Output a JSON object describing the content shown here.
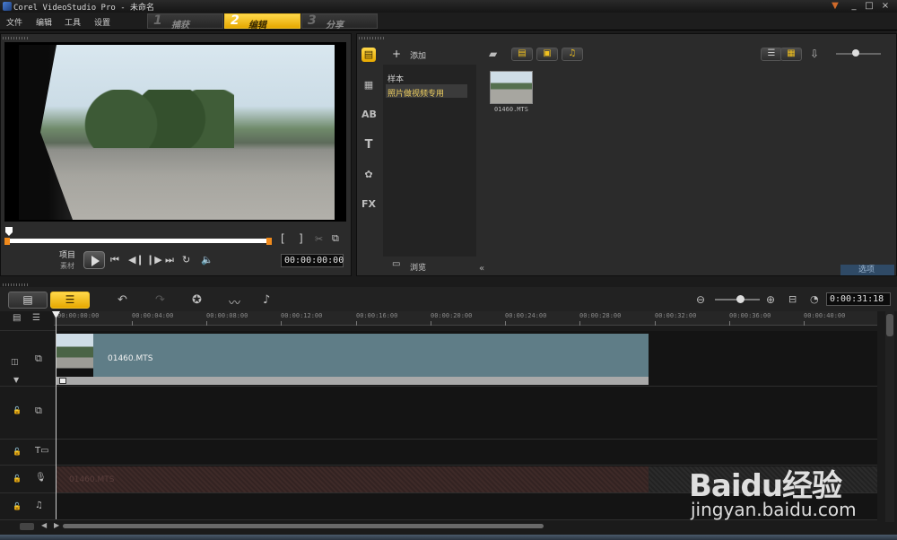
{
  "window": {
    "title": "Corel VideoStudio Pro - 未命名",
    "controls": [
      "▼",
      "_",
      "□",
      "×"
    ]
  },
  "menu": [
    "文件",
    "编辑",
    "工具",
    "设置"
  ],
  "steps": [
    {
      "num": "1",
      "label": "捕获"
    },
    {
      "num": "2",
      "label": "编辑"
    },
    {
      "num": "3",
      "label": "分享"
    }
  ],
  "player": {
    "project_label": "项目",
    "clip_label": "素材",
    "mark_in": "[",
    "mark_out": "]",
    "timecode": "00:00:00:00"
  },
  "library": {
    "add_label": "添加",
    "folders": [
      "样本",
      "照片做视频专用"
    ],
    "browse_label": "浏览",
    "options_label": "选项",
    "thumb_name": "01460.MTS"
  },
  "timeline": {
    "total_duration": "0:00:31:18",
    "ruler_ticks": [
      "00:00:00:00",
      "00:00:04:00",
      "00:00:08:00",
      "00:00:12:00",
      "00:00:16:00",
      "00:00:20:00",
      "00:00:24:00",
      "00:00:28:00",
      "00:00:32:00",
      "00:00:36:00",
      "00:00:40:00"
    ],
    "video_clip_label": "01460.MTS",
    "audio_clip_label": "01460.MTS"
  },
  "watermark": {
    "logo": "Baidu经验",
    "url": "jingyan.baidu.com"
  }
}
